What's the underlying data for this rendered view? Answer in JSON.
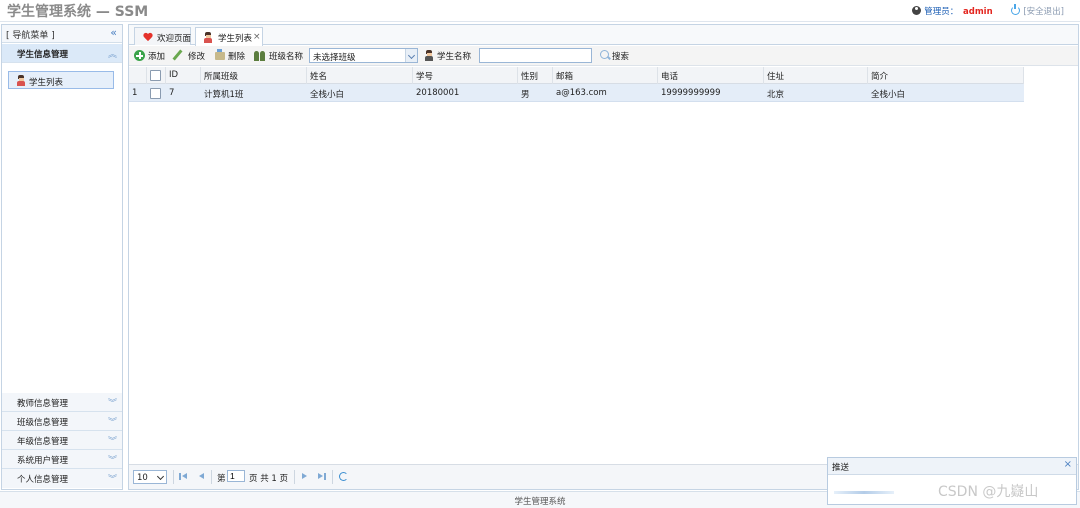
{
  "header": {
    "title": "学生管理系统 — SSM",
    "role_label": "管理员：",
    "username": "admin",
    "logout_label": "[安全退出]",
    "colors": {
      "username": "#e3261f",
      "role": "#1d5fb5",
      "title": "#8a8a8a"
    }
  },
  "sidebar": {
    "title": "[ 导航菜单 ]",
    "active_section": "学生信息管理",
    "active_item": "学生列表",
    "sections": [
      "教师信息管理",
      "班级信息管理",
      "年级信息管理",
      "系统用户管理",
      "个人信息管理"
    ]
  },
  "tabs": [
    {
      "label": "欢迎页面",
      "icon": "heart-icon"
    },
    {
      "label": "学生列表",
      "icon": "student-icon",
      "close": "×"
    }
  ],
  "toolbar": {
    "add_label": "添加",
    "edit_label": "修改",
    "delete_label": "删除",
    "class_label": "班级名称",
    "class_value": "未选择班级",
    "student_label": "学生名称",
    "search_label": "搜索"
  },
  "grid": {
    "columns": [
      "ID",
      "所属班级",
      "姓名",
      "学号",
      "性别",
      "邮箱",
      "电话",
      "住址",
      "简介"
    ],
    "rows": [
      {
        "index": "1",
        "id": "7",
        "class": "计算机1班",
        "name": "全栈小白",
        "number": "20180001",
        "gender": "男",
        "email": "a@163.com",
        "phone": "19999999999",
        "address": "北京",
        "intro": "全栈小白"
      }
    ]
  },
  "pager": {
    "page_size": "10",
    "page_prefix": "第",
    "page_value": "1",
    "page_suffix": "页 共 1 页"
  },
  "footer": {
    "text": "学生管理系统"
  },
  "popup": {
    "title": "推送",
    "close": "×"
  },
  "watermark": "CSDN @九嶷山"
}
